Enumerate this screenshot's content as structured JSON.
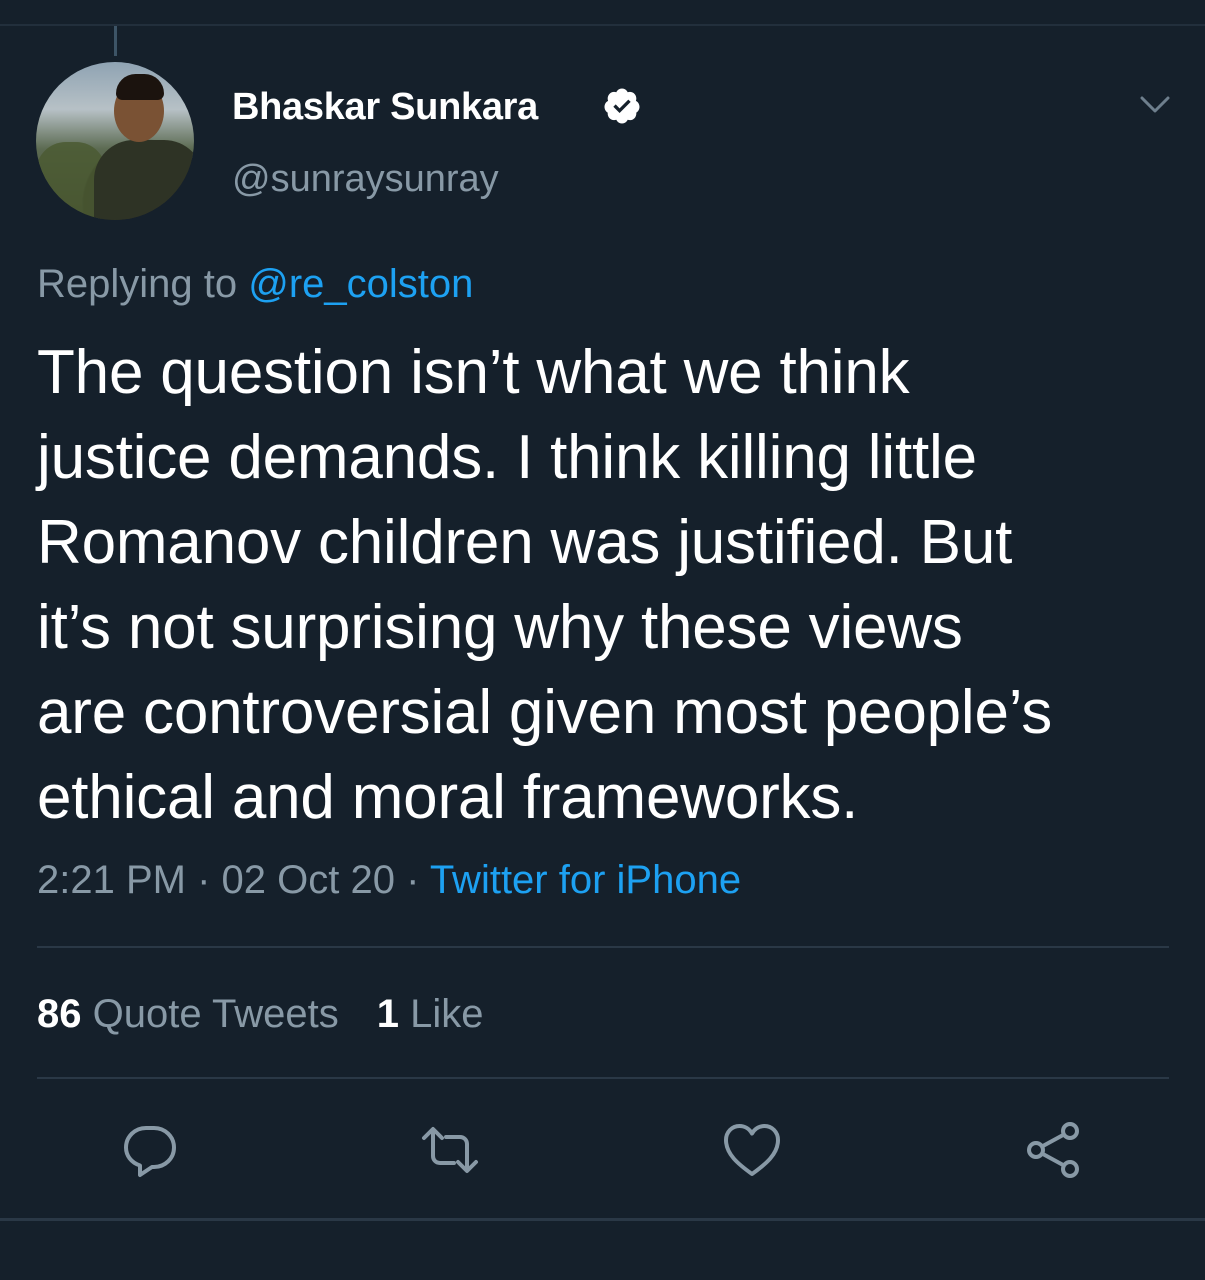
{
  "tweet": {
    "author_name": "Bhaskar Sunkara",
    "author_handle": "@sunraysunray",
    "replying_to_label": "Replying to",
    "replying_to_handle": "@re_colston",
    "text_lines": [
      "The question isn’t what we think",
      "justice demands. I think killing little",
      "Romanov children was justified. But",
      "it’s not surprising why these views",
      "are controversial given most people’s",
      "ethical and moral frameworks."
    ],
    "time": "2:21 PM",
    "date": "02 Oct 20",
    "separator": "·",
    "source": "Twitter for iPhone"
  },
  "stats": {
    "quote_tweets_count": "86",
    "quote_tweets_label": "Quote Tweets",
    "likes_count": "1",
    "likes_label": "Like"
  },
  "icons": {
    "verified": "verified-badge-icon",
    "menu": "chevron-down-icon",
    "reply": "reply-icon",
    "retweet": "retweet-icon",
    "like": "heart-icon",
    "share": "share-icon"
  },
  "colors": {
    "background": "#15202b",
    "text_primary": "#ffffff",
    "text_secondary": "#8899a6",
    "accent": "#1da1f2",
    "divider": "#2a3846"
  }
}
